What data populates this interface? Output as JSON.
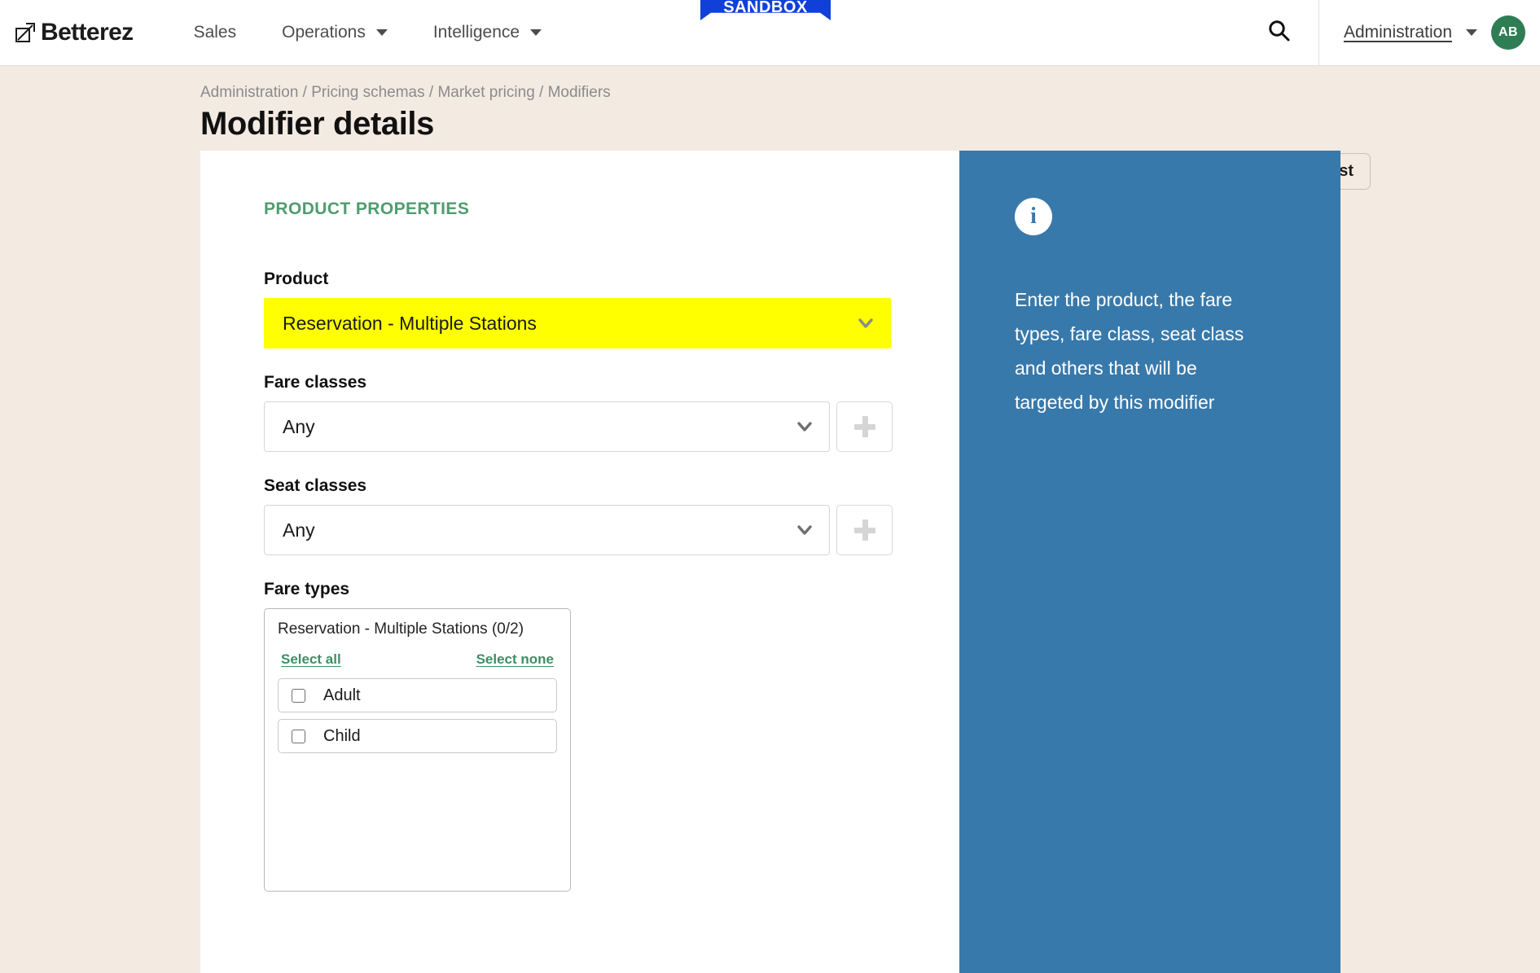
{
  "topnav": {
    "brand": "Betterez",
    "brand_icon": "arrow-logo-icon",
    "items": [
      {
        "label": "Sales",
        "has_caret": false
      },
      {
        "label": "Operations",
        "has_caret": true
      },
      {
        "label": "Intelligence",
        "has_caret": true
      }
    ],
    "sandbox_badge": "SANDBOX",
    "search_icon": "search-icon",
    "account_label": "Administration",
    "avatar_initials": "AB",
    "avatar_color": "#2e7d54"
  },
  "header": {
    "breadcrumb": "Administration / Pricing schemas / Market pricing / Modifiers",
    "title": "Modifier details",
    "back_button": "Back to the list"
  },
  "card": {
    "section_title": "PRODUCT PROPERTIES",
    "section_title_color": "#4f9d6e",
    "product": {
      "label": "Product",
      "value": "Reservation - Multiple Stations",
      "highlight_color": "#ffff00"
    },
    "fare_classes": {
      "label": "Fare classes",
      "value": "Any",
      "add_button": "+"
    },
    "seat_classes": {
      "label": "Seat classes",
      "value": "Any",
      "add_button": "+"
    },
    "fare_types": {
      "label": "Fare types",
      "group_header": "Reservation - Multiple Stations (0/2)",
      "select_all": "Select all",
      "select_none": "Select none",
      "link_color": "#3c8f63",
      "options": [
        {
          "label": "Adult",
          "checked": false
        },
        {
          "label": "Child",
          "checked": false
        }
      ]
    }
  },
  "info_panel": {
    "icon": "info-icon",
    "background": "#3879ab",
    "text": "Enter the product, the fare types, fare class, seat class and others that will be targeted by this modifier"
  }
}
